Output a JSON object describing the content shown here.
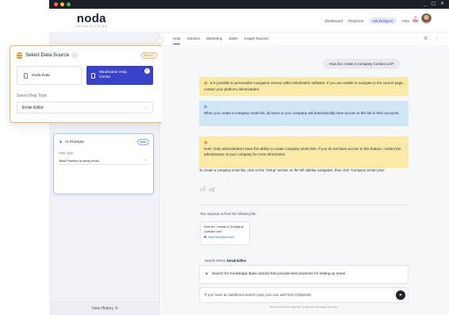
{
  "window": {
    "controls": "_ □ ✕",
    "traffic_colors": [
      "#ff5f57",
      "#febc2e",
      "#28c840"
    ]
  },
  "header": {
    "logo_text": "noda",
    "logo_subtitle": "TECHNOLOGIES",
    "nav": [
      "Dashboard",
      "Playbook",
      "Ask BridgeAI",
      "Help"
    ],
    "active_nav": "Ask BridgeAI"
  },
  "sidebar": {
    "collapse_icon": "chevron-left-icon",
    "ai_prompts": {
      "title": "AI Prompts",
      "badge": "Beta",
      "help_type_label": "Help Type",
      "help_type_value": "Best Practice to setup email"
    },
    "view_history_label": "View History"
  },
  "data_source_popup": {
    "title": "Select Data Source",
    "badge": "Beta 01",
    "options": [
      {
        "label": "Noda Data",
        "selected": false
      },
      {
        "label": "Mindmatrix Help Center",
        "selected": true
      }
    ],
    "help_topic_label": "Select Help Topic",
    "help_topic_value": "Email Editor"
  },
  "tabs": [
    "Help",
    "Solution",
    "Marketing",
    "Sales",
    "Insight Reports"
  ],
  "active_tab": "Help",
  "chat": {
    "user_question": "How do I create a Company Contact List?",
    "notes": [
      {
        "kind": "warning",
        "text": "It is possible to personalize navigation menus within Mindmatrix software. If you are unable to navigate to the correct page, contact your platform administrator."
      },
      {
        "kind": "info",
        "text": "When you create a company smart list, all users in your company will automatically have access to this list in their accounts."
      },
      {
        "kind": "warning",
        "text": "Note: Only administrators have the ability to create company smart lists. If you do not have access to this feature, contact the administrator at your company for more information."
      }
    ],
    "answer_text": "To create a company smart list, click on the \"Setup\" section on the left sidebar navigation, then click \"Company Smart Lists\".",
    "source_label": "The response is from the following file:",
    "source_card": {
      "title": "How do I create a Company Contact List?",
      "link": "https://helpdesk.mindm..."
    },
    "search_term_label": "Search Terms:",
    "search_term_value": "Email Editor",
    "prompt_text": "Search for Knowledge Base articles that provide best practices for setting up email",
    "input_placeholder": "If you have an additional search topic you can add here (Optional)",
    "disclaimer": "Please review the response. AI data are not always accurate."
  },
  "colors": {
    "accent": "#3942c7",
    "warning_note": "#fbeaa7",
    "info_note": "#cfe6f7",
    "popup_border": "#efb36a"
  }
}
